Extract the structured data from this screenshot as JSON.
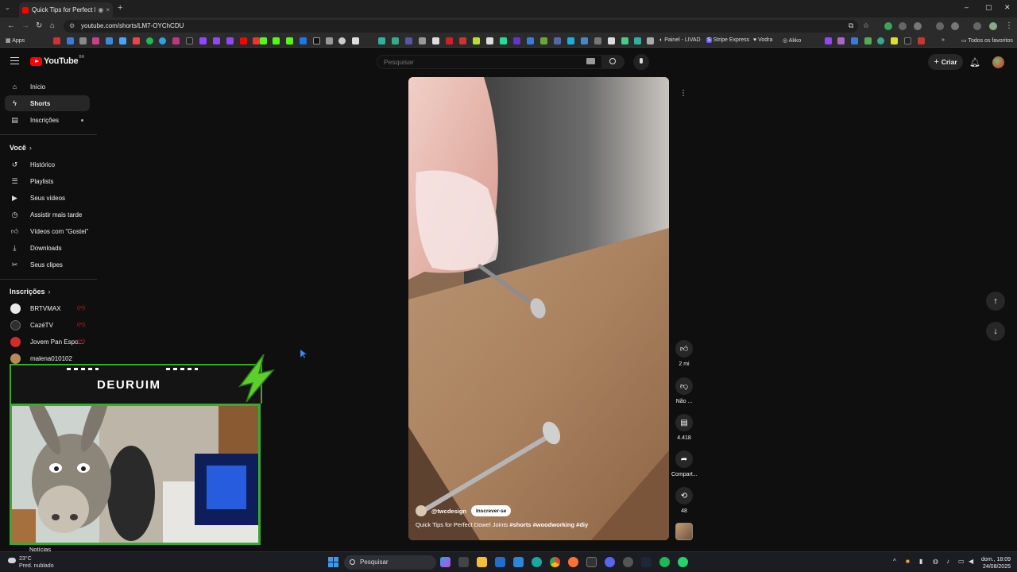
{
  "browser": {
    "tab_title": "Quick Tips for Perfect Dowel Joints",
    "url": "youtube.com/shorts/LM7-OYChCDU",
    "bookmarks": {
      "apps": "Apps",
      "painel": "Painel - LIVAD",
      "stripe": "Stripe Express",
      "vodra": "Vodra",
      "akko": "Akko",
      "all_favorites": "Todos os favoritos"
    }
  },
  "header": {
    "logo_text": "YouTube",
    "country": "BR",
    "search_placeholder": "Pesquisar",
    "create_label": "Criar"
  },
  "sidebar": {
    "main": [
      {
        "label": "Início",
        "icon": "home-icon"
      },
      {
        "label": "Shorts",
        "icon": "shorts-icon"
      },
      {
        "label": "Inscrições",
        "icon": "subscriptions-icon"
      }
    ],
    "you_section": "Você",
    "you_items": [
      {
        "label": "Histórico",
        "icon": "history-icon"
      },
      {
        "label": "Playlists",
        "icon": "playlists-icon"
      },
      {
        "label": "Seus vídeos",
        "icon": "your-videos-icon"
      },
      {
        "label": "Assistir mais tarde",
        "icon": "watch-later-icon"
      },
      {
        "label": "Vídeos com \"Gostei\"",
        "icon": "liked-icon"
      },
      {
        "label": "Downloads",
        "icon": "download-icon"
      },
      {
        "label": "Seus clipes",
        "icon": "clips-icon"
      }
    ],
    "subs_section": "Inscrições",
    "channels": [
      {
        "name": "BRTVMAX",
        "color": "#e9e9e9"
      },
      {
        "name": "CazéTV",
        "color": "#2e2e2e"
      },
      {
        "name": "Jovem Pan Espo...",
        "color": "#d32a2a"
      },
      {
        "name": "malena010102",
        "color": "#b88a5a"
      }
    ],
    "news_label": "Notícias"
  },
  "short": {
    "channel": "@twcdesign",
    "subscribe_label": "Inscrever-se",
    "title": "Quick Tips for Perfect Dowel Joints",
    "hashtags": "#shorts #woodworking #diy",
    "likes": "2 mi",
    "dislike_label": "Não ...",
    "comments": "4.418",
    "share_label": "Compart...",
    "remix_count": "48"
  },
  "stream_overlay": {
    "name": "DEURUIM",
    "accent": "#3ba82e"
  },
  "taskbar": {
    "temperature": "23°C",
    "weather": "Pred. nublado",
    "search_label": "Pesquisar",
    "day": "dom., 18:09",
    "date": "24/08/2025"
  }
}
